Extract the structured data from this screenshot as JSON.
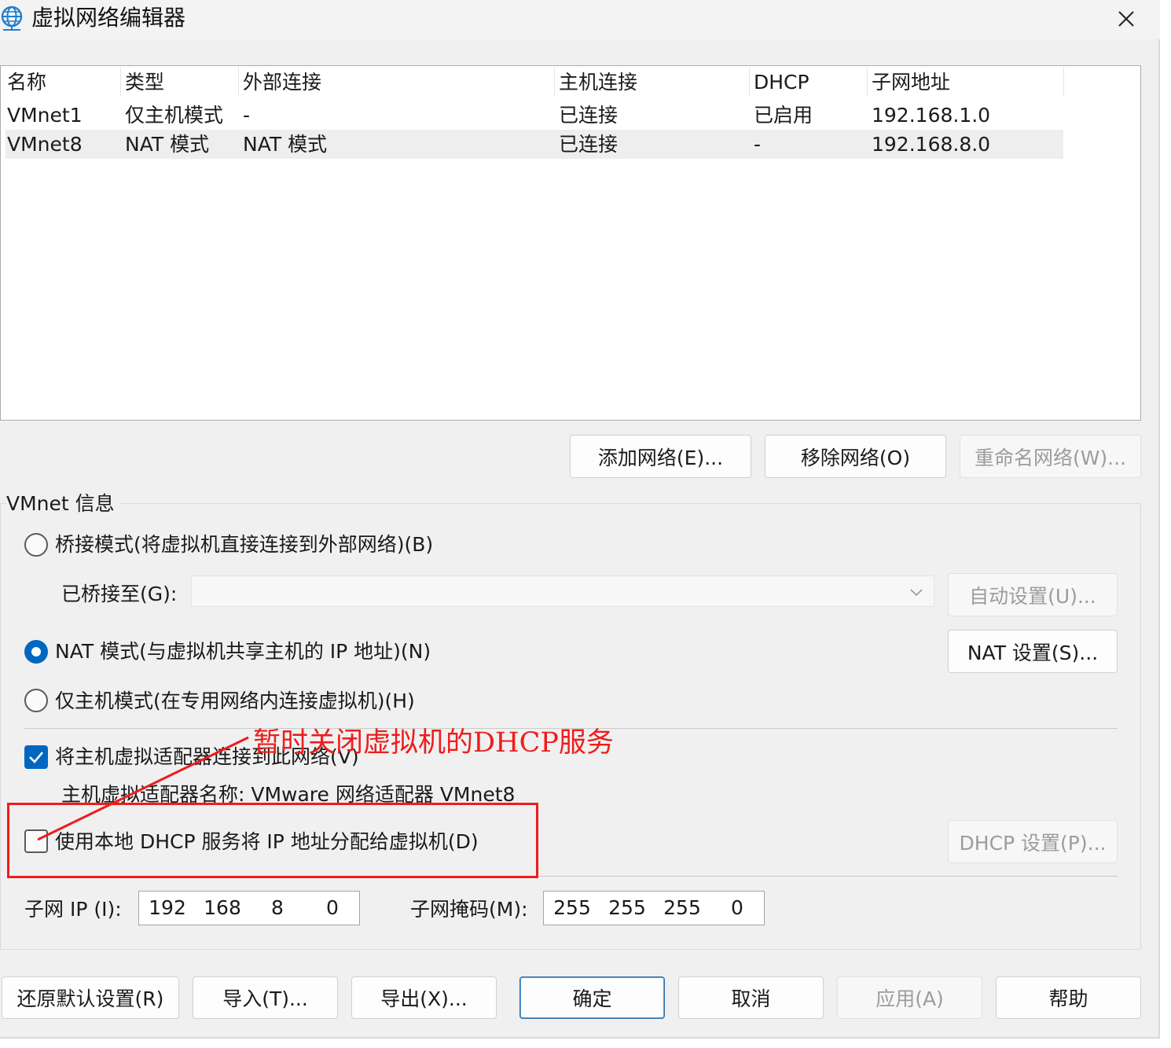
{
  "window": {
    "title": "虚拟网络编辑器",
    "close_glyph": "✕"
  },
  "network_table": {
    "columns": [
      "名称",
      "类型",
      "外部连接",
      "主机连接",
      "DHCP",
      "子网地址"
    ],
    "rows": [
      [
        "VMnet1",
        "仅主机模式",
        "-",
        "已连接",
        "已启用",
        "192.168.1.0"
      ],
      [
        "VMnet8",
        "NAT 模式",
        "NAT 模式",
        "已连接",
        "-",
        "192.168.8.0"
      ]
    ],
    "selected_row": 1
  },
  "network_actions": {
    "add": "添加网络(E)...",
    "remove": "移除网络(O)",
    "rename": "重命名网络(W)..."
  },
  "vmnet_info": {
    "title": "VMnet 信息",
    "bridged_label": "桥接模式(将虚拟机直接连接到外部网络)(B)",
    "bridged_to_label": "已桥接至(G):",
    "bridged_to_value": "",
    "auto_settings": "自动设置(U)...",
    "nat_label": "NAT 模式(与虚拟机共享主机的 IP 地址)(N)",
    "nat_settings": "NAT 设置(S)...",
    "host_only_label": "仅主机模式(在专用网络内连接虚拟机)(H)",
    "selected_mode": "nat",
    "connect_adapter_label": "将主机虚拟适配器连接到此网络(V)",
    "connect_adapter_checked": true,
    "adapter_name_label": "主机虚拟适配器名称: VMware 网络适配器 VMnet8",
    "dhcp_label": "使用本地 DHCP 服务将 IP 地址分配给虚拟机(D)",
    "dhcp_checked": false,
    "dhcp_settings": "DHCP 设置(P)...",
    "subnet_ip_label": "子网 IP (I):",
    "subnet_ip": [
      "192",
      "168",
      "8",
      "0"
    ],
    "subnet_mask_label": "子网掩码(M):",
    "subnet_mask": [
      "255",
      "255",
      "255",
      "0"
    ]
  },
  "footer": {
    "restore_defaults": "还原默认设置(R)",
    "import": "导入(T)...",
    "export": "导出(X)...",
    "ok": "确定",
    "cancel": "取消",
    "apply": "应用(A)",
    "help": "帮助"
  },
  "annotation": {
    "text": "暂时关闭虚拟机的DHCP服务",
    "color": "#ef1c1c"
  },
  "colors": {
    "accent": "#0067c0",
    "dialog_bg": "#f0f0f0"
  }
}
